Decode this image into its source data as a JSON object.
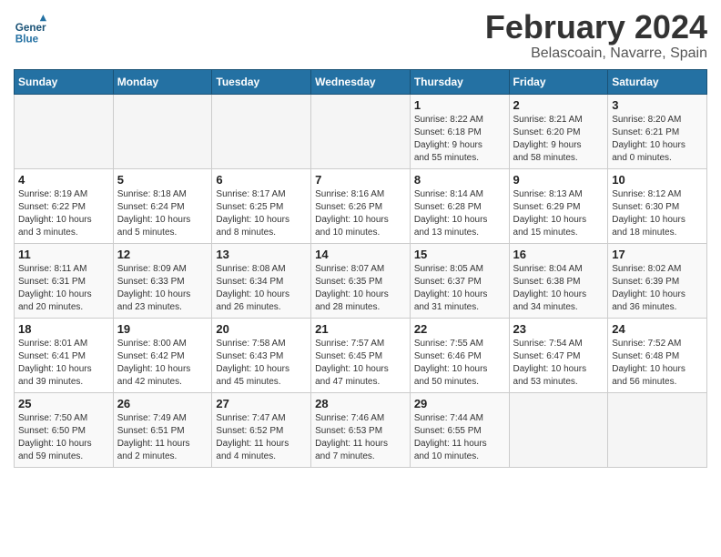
{
  "header": {
    "logo_line1": "General",
    "logo_line2": "Blue",
    "title": "February 2024",
    "subtitle": "Belascoain, Navarre, Spain"
  },
  "columns": [
    "Sunday",
    "Monday",
    "Tuesday",
    "Wednesday",
    "Thursday",
    "Friday",
    "Saturday"
  ],
  "weeks": [
    [
      {
        "num": "",
        "info": ""
      },
      {
        "num": "",
        "info": ""
      },
      {
        "num": "",
        "info": ""
      },
      {
        "num": "",
        "info": ""
      },
      {
        "num": "1",
        "info": "Sunrise: 8:22 AM\nSunset: 6:18 PM\nDaylight: 9 hours\nand 55 minutes."
      },
      {
        "num": "2",
        "info": "Sunrise: 8:21 AM\nSunset: 6:20 PM\nDaylight: 9 hours\nand 58 minutes."
      },
      {
        "num": "3",
        "info": "Sunrise: 8:20 AM\nSunset: 6:21 PM\nDaylight: 10 hours\nand 0 minutes."
      }
    ],
    [
      {
        "num": "4",
        "info": "Sunrise: 8:19 AM\nSunset: 6:22 PM\nDaylight: 10 hours\nand 3 minutes."
      },
      {
        "num": "5",
        "info": "Sunrise: 8:18 AM\nSunset: 6:24 PM\nDaylight: 10 hours\nand 5 minutes."
      },
      {
        "num": "6",
        "info": "Sunrise: 8:17 AM\nSunset: 6:25 PM\nDaylight: 10 hours\nand 8 minutes."
      },
      {
        "num": "7",
        "info": "Sunrise: 8:16 AM\nSunset: 6:26 PM\nDaylight: 10 hours\nand 10 minutes."
      },
      {
        "num": "8",
        "info": "Sunrise: 8:14 AM\nSunset: 6:28 PM\nDaylight: 10 hours\nand 13 minutes."
      },
      {
        "num": "9",
        "info": "Sunrise: 8:13 AM\nSunset: 6:29 PM\nDaylight: 10 hours\nand 15 minutes."
      },
      {
        "num": "10",
        "info": "Sunrise: 8:12 AM\nSunset: 6:30 PM\nDaylight: 10 hours\nand 18 minutes."
      }
    ],
    [
      {
        "num": "11",
        "info": "Sunrise: 8:11 AM\nSunset: 6:31 PM\nDaylight: 10 hours\nand 20 minutes."
      },
      {
        "num": "12",
        "info": "Sunrise: 8:09 AM\nSunset: 6:33 PM\nDaylight: 10 hours\nand 23 minutes."
      },
      {
        "num": "13",
        "info": "Sunrise: 8:08 AM\nSunset: 6:34 PM\nDaylight: 10 hours\nand 26 minutes."
      },
      {
        "num": "14",
        "info": "Sunrise: 8:07 AM\nSunset: 6:35 PM\nDaylight: 10 hours\nand 28 minutes."
      },
      {
        "num": "15",
        "info": "Sunrise: 8:05 AM\nSunset: 6:37 PM\nDaylight: 10 hours\nand 31 minutes."
      },
      {
        "num": "16",
        "info": "Sunrise: 8:04 AM\nSunset: 6:38 PM\nDaylight: 10 hours\nand 34 minutes."
      },
      {
        "num": "17",
        "info": "Sunrise: 8:02 AM\nSunset: 6:39 PM\nDaylight: 10 hours\nand 36 minutes."
      }
    ],
    [
      {
        "num": "18",
        "info": "Sunrise: 8:01 AM\nSunset: 6:41 PM\nDaylight: 10 hours\nand 39 minutes."
      },
      {
        "num": "19",
        "info": "Sunrise: 8:00 AM\nSunset: 6:42 PM\nDaylight: 10 hours\nand 42 minutes."
      },
      {
        "num": "20",
        "info": "Sunrise: 7:58 AM\nSunset: 6:43 PM\nDaylight: 10 hours\nand 45 minutes."
      },
      {
        "num": "21",
        "info": "Sunrise: 7:57 AM\nSunset: 6:45 PM\nDaylight: 10 hours\nand 47 minutes."
      },
      {
        "num": "22",
        "info": "Sunrise: 7:55 AM\nSunset: 6:46 PM\nDaylight: 10 hours\nand 50 minutes."
      },
      {
        "num": "23",
        "info": "Sunrise: 7:54 AM\nSunset: 6:47 PM\nDaylight: 10 hours\nand 53 minutes."
      },
      {
        "num": "24",
        "info": "Sunrise: 7:52 AM\nSunset: 6:48 PM\nDaylight: 10 hours\nand 56 minutes."
      }
    ],
    [
      {
        "num": "25",
        "info": "Sunrise: 7:50 AM\nSunset: 6:50 PM\nDaylight: 10 hours\nand 59 minutes."
      },
      {
        "num": "26",
        "info": "Sunrise: 7:49 AM\nSunset: 6:51 PM\nDaylight: 11 hours\nand 2 minutes."
      },
      {
        "num": "27",
        "info": "Sunrise: 7:47 AM\nSunset: 6:52 PM\nDaylight: 11 hours\nand 4 minutes."
      },
      {
        "num": "28",
        "info": "Sunrise: 7:46 AM\nSunset: 6:53 PM\nDaylight: 11 hours\nand 7 minutes."
      },
      {
        "num": "29",
        "info": "Sunrise: 7:44 AM\nSunset: 6:55 PM\nDaylight: 11 hours\nand 10 minutes."
      },
      {
        "num": "",
        "info": ""
      },
      {
        "num": "",
        "info": ""
      }
    ]
  ]
}
